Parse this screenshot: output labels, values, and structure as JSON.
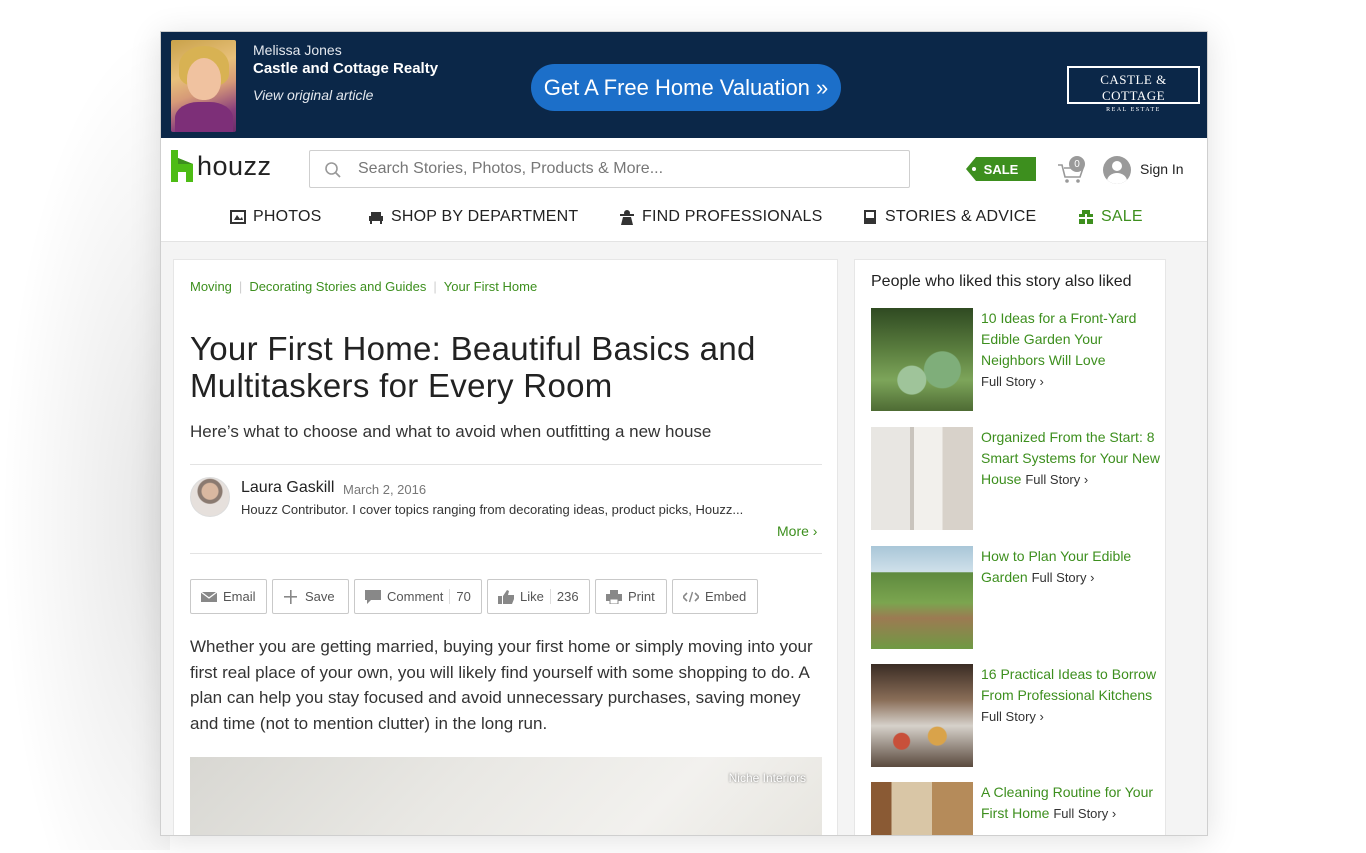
{
  "banner": {
    "agent_name": "Melissa Jones",
    "company": "Castle and Cottage Realty",
    "link": "View original article",
    "cta": "Get A Free Home Valuation »",
    "brand_main": "CASTLE & COTTAGE",
    "brand_sub": "REAL ESTATE"
  },
  "header": {
    "logo": "houzz",
    "search_placeholder": "Search Stories, Photos, Products & More...",
    "sale_tag": "SALE",
    "cart_count": "0",
    "sign_in": "Sign In"
  },
  "nav": {
    "items": [
      {
        "label": "PHOTOS",
        "icon": "photos-icon"
      },
      {
        "label": "SHOP BY DEPARTMENT",
        "icon": "sofa-icon"
      },
      {
        "label": "FIND PROFESSIONALS",
        "icon": "professional-icon"
      },
      {
        "label": "STORIES & ADVICE",
        "icon": "book-icon"
      },
      {
        "label": "SALE",
        "icon": "gift-icon"
      }
    ]
  },
  "article": {
    "breadcrumbs": [
      "Moving",
      "Decorating Stories and Guides",
      "Your First Home"
    ],
    "title": "Your First Home: Beautiful Basics and Multitaskers for Every Room",
    "subtitle": "Here’s what to choose and what to avoid when outfitting a new house",
    "author": {
      "name": "Laura Gaskill",
      "date": "March 2, 2016",
      "bio": "Houzz Contributor. I cover topics ranging from decorating ideas, product picks, Houzz...",
      "more": "More"
    },
    "actions": {
      "email": "Email",
      "save": "Save",
      "comment": "Comment",
      "comment_count": "70",
      "like": "Like",
      "like_count": "236",
      "print": "Print",
      "embed": "Embed"
    },
    "body": "Whether you are getting married, buying your first home or simply moving into your first real place of your own, you will likely find yourself with some shopping to do. A plan can help you stay focused and avoid unnecessary purchases, saving money and time (not to mention clutter) in the long run.",
    "image_credit": "Niche Interiors"
  },
  "sidebar": {
    "title": "People who liked this story also liked",
    "full_story": "Full Story",
    "stories": [
      {
        "title": "10 Ideas for a Front-Yard Edible Garden Your Neighbors Will Love"
      },
      {
        "title": "Organized From the Start: 8 Smart Systems for Your New House"
      },
      {
        "title": "How to Plan Your Edible Garden"
      },
      {
        "title": "16 Practical Ideas to Borrow From Professional Kitchens"
      },
      {
        "title": "A Cleaning Routine for Your First Home"
      }
    ]
  },
  "colors": {
    "banner_bg": "#0b2748",
    "cta_blue": "#1c6fc9",
    "houzz_green": "#3d8f1e"
  }
}
